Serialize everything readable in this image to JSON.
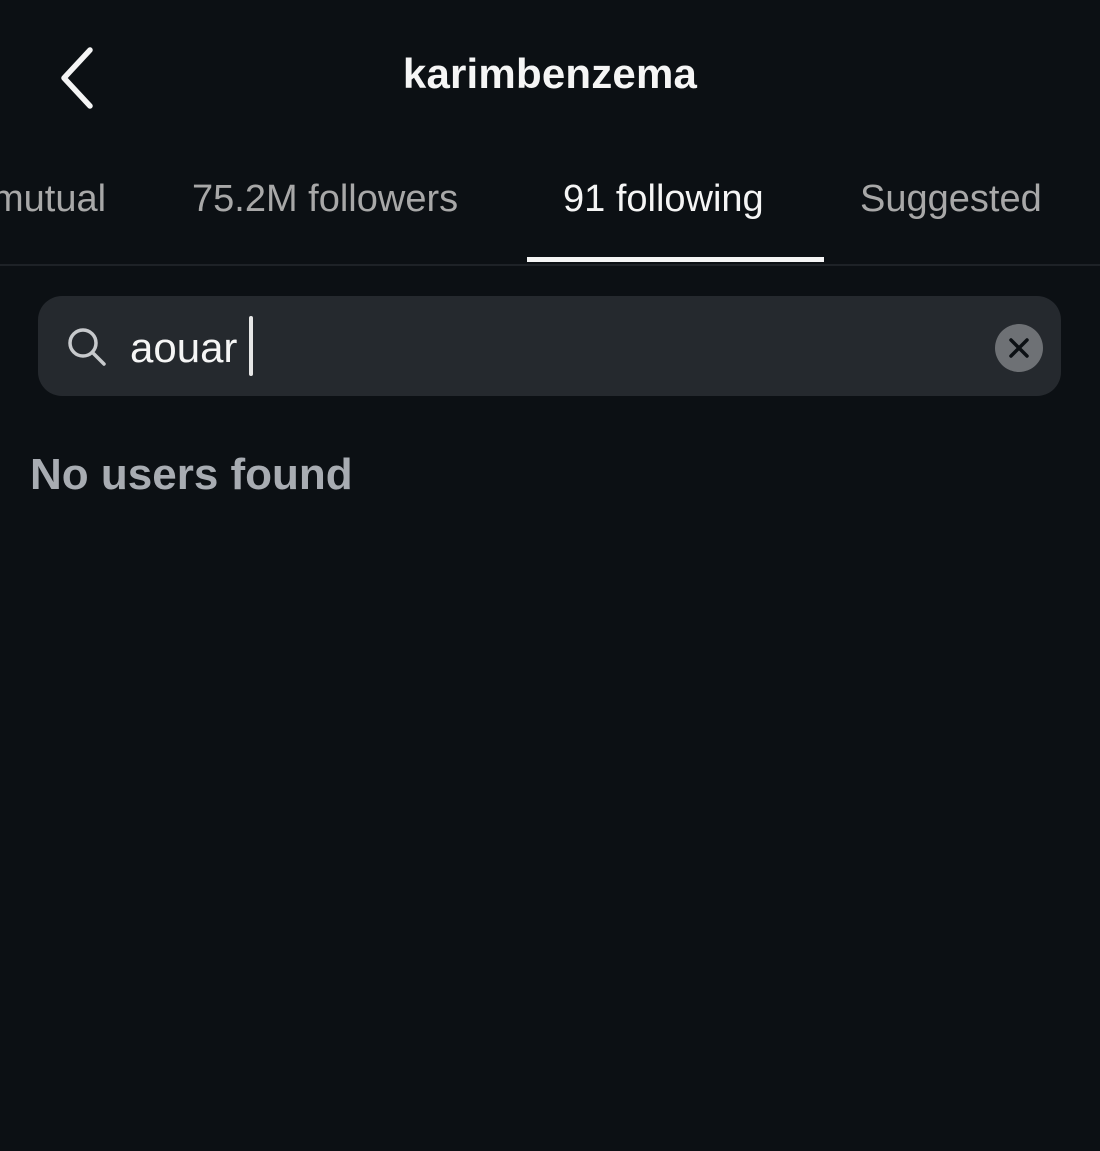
{
  "header": {
    "title": "karimbenzema",
    "back_icon": "chevron-left-icon"
  },
  "tabs": [
    {
      "label": "mutual",
      "active": false
    },
    {
      "label": "75.2M followers",
      "active": false
    },
    {
      "label": "91 following",
      "active": true
    },
    {
      "label": "Suggested",
      "active": false
    }
  ],
  "search": {
    "value": "aouar",
    "icon": "search-icon",
    "clear_icon": "clear-icon"
  },
  "results": {
    "empty_message": "No users found"
  },
  "colors": {
    "background": "#0c1014",
    "search_field": "#25292e",
    "active_text": "#f5f5f5",
    "inactive_text": "#a8a8a8"
  }
}
